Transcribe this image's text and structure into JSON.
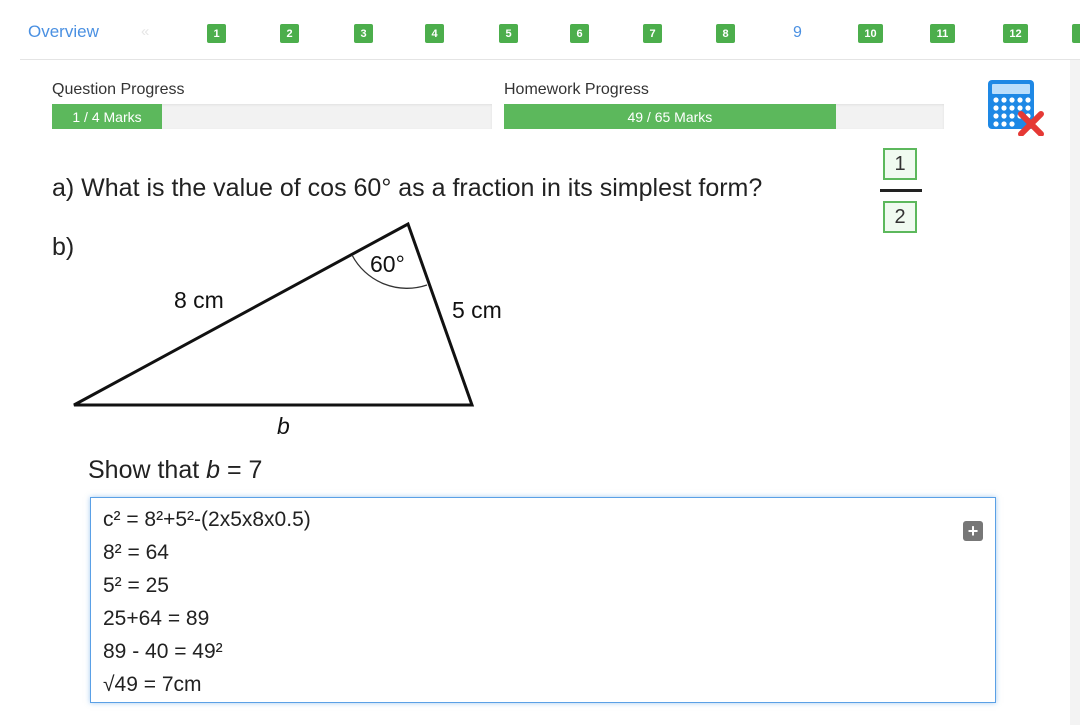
{
  "nav": {
    "overview_label": "Overview",
    "prev_arrow": "«",
    "questions": [
      "1",
      "2",
      "3",
      "4",
      "5",
      "6",
      "7",
      "8",
      "9",
      "10",
      "11",
      "12"
    ],
    "current_question": "9"
  },
  "progress": {
    "question": {
      "label": "Question Progress",
      "text": "1 / 4 Marks",
      "fraction": 0.25
    },
    "homework": {
      "label": "Homework Progress",
      "text": "49 / 65 Marks",
      "fraction": 0.754
    }
  },
  "calculator": {
    "icon": "calculator-not-allowed-icon"
  },
  "question_a": {
    "text": "a)  What is the value of cos 60° as a fraction in its simplest form?",
    "numerator": "1",
    "denominator": "2"
  },
  "question_b": {
    "label": "b)",
    "diagram": {
      "side_left": "8 cm",
      "side_right": "5 cm",
      "angle": "60°",
      "side_bottom": "b"
    },
    "instruction_prefix": "Show that ",
    "instruction_var": "b",
    "instruction_suffix": " = 7"
  },
  "answer": {
    "lines": [
      "c² = 8²+5²-(2x5x8x0.5)",
      "8² = 64",
      "5² = 25",
      "25+64 = 89",
      "89 - 40 = 49²",
      "√49 = 7cm"
    ],
    "expand_button": "+"
  },
  "colors": {
    "accent": "#5cb85c",
    "link": "#4a90e2",
    "focus": "#5aa0e6"
  }
}
